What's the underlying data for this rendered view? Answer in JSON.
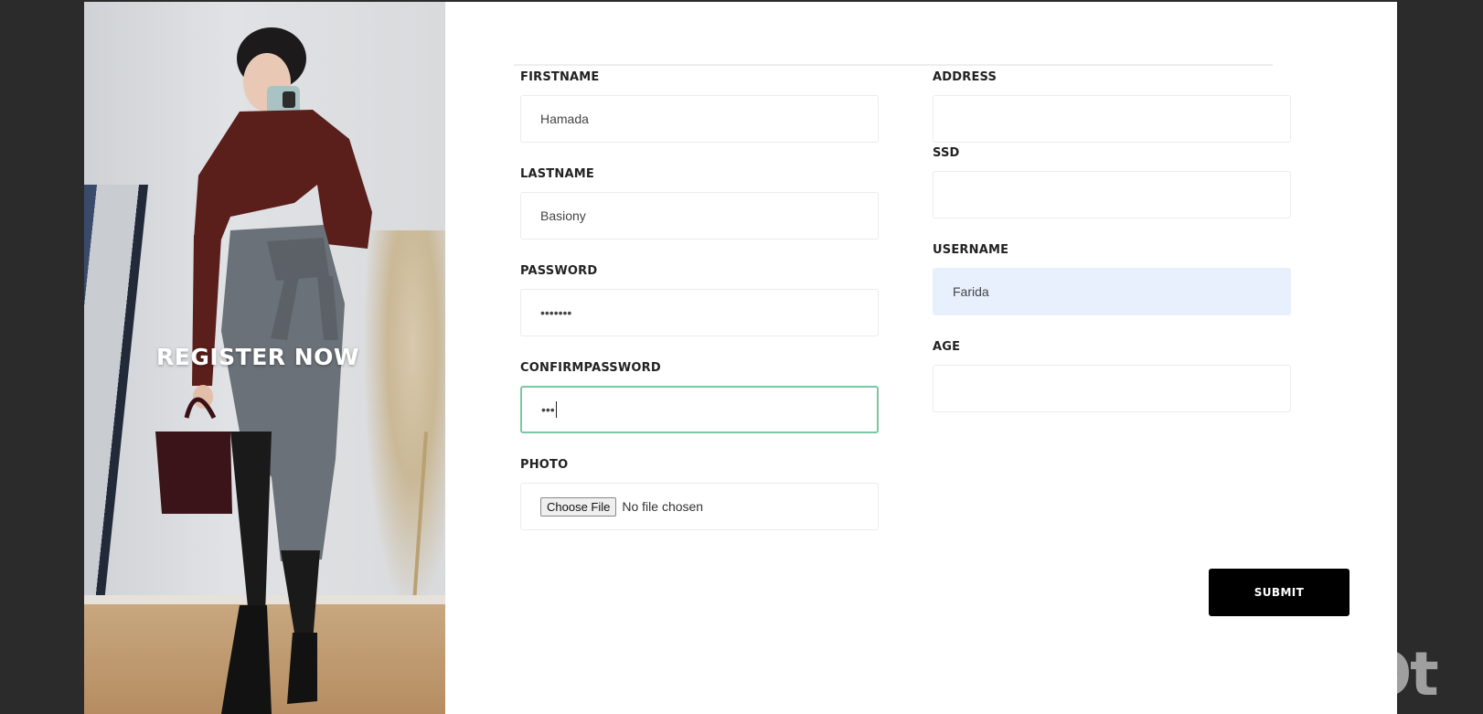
{
  "hero": {
    "headline": "REGISTER NOW"
  },
  "form": {
    "left_fields": [
      {
        "label": "FIRSTNAME",
        "value": "Hamada"
      },
      {
        "label": "LASTNAME",
        "value": "Basiony"
      },
      {
        "label": "PASSWORD",
        "value": "•••••••"
      },
      {
        "label": "CONFIRMPASSWORD",
        "value": "•••"
      }
    ],
    "photo": {
      "label": "PHOTO",
      "button_label": "Choose File",
      "status": "No file chosen"
    },
    "right_fields": [
      {
        "label": "ADDRESS",
        "value": ""
      },
      {
        "label": "SSD",
        "value": ""
      },
      {
        "label": "USERNAME",
        "value": "Farida"
      },
      {
        "label": "AGE",
        "value": ""
      }
    ],
    "submit_label": "SUBMIT"
  },
  "watermark": "InShOt",
  "colors": {
    "background": "#2b2b2b",
    "focus_border": "#7dc7a4",
    "autofill_bg": "#e8f0fe",
    "submit_bg": "#000000"
  }
}
